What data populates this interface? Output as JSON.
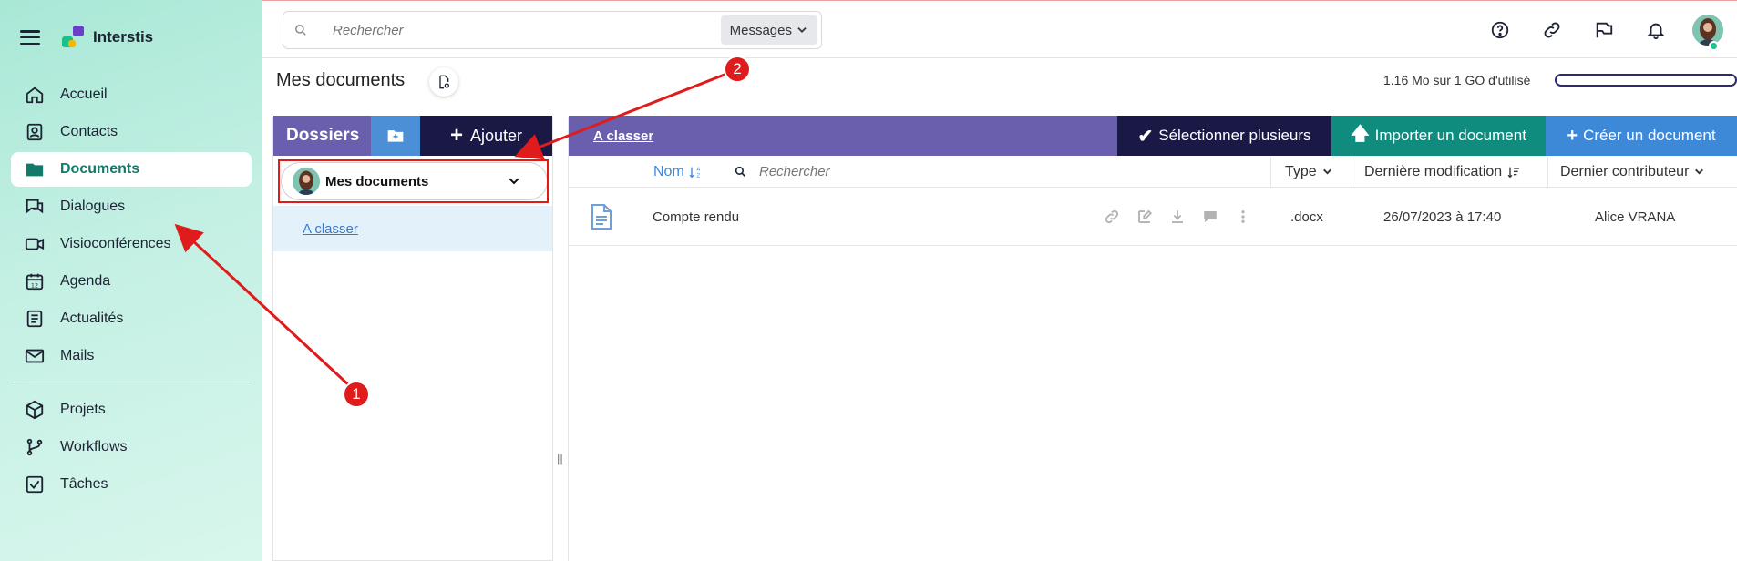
{
  "app": {
    "name": "Interstis"
  },
  "search": {
    "placeholder": "Rechercher",
    "scope": "Messages"
  },
  "sidebar": {
    "items": [
      {
        "label": "Accueil",
        "icon": "home-icon"
      },
      {
        "label": "Contacts",
        "icon": "contact-card-icon"
      },
      {
        "label": "Documents",
        "icon": "folder-icon",
        "active": true
      },
      {
        "label": "Dialogues",
        "icon": "chat-icon"
      },
      {
        "label": "Visioconférences",
        "icon": "video-icon"
      },
      {
        "label": "Agenda",
        "icon": "calendar-icon"
      },
      {
        "label": "Actualités",
        "icon": "news-icon"
      },
      {
        "label": "Mails",
        "icon": "mail-icon"
      },
      {
        "label": "Projets",
        "icon": "cube-icon"
      },
      {
        "label": "Workflows",
        "icon": "branch-icon"
      },
      {
        "label": "Tâches",
        "icon": "checkbox-icon"
      }
    ]
  },
  "topbar": {
    "icons": [
      "help-icon",
      "link-icon",
      "feedback-icon",
      "bell-icon",
      "user-avatar"
    ]
  },
  "page": {
    "title": "Mes documents",
    "usage": "1.16 Mo sur 1 GO d'utilisé",
    "usage_fraction": 0.001
  },
  "folders": {
    "title": "Dossiers",
    "add_label": "Ajouter",
    "selected": "Mes documents",
    "items": [
      "A classer"
    ]
  },
  "documents": {
    "path": "A classer",
    "buttons": {
      "select_multiple": "Sélectionner plusieurs",
      "import": "Importer un document",
      "create": "Créer un document"
    },
    "columns": {
      "name": "Nom",
      "search_placeholder": "Rechercher",
      "type": "Type",
      "modified": "Dernière modification",
      "contributor": "Dernier contributeur"
    },
    "rows": [
      {
        "name": "Compte rendu",
        "type": ".docx",
        "modified": "26/07/2023 à 17:40",
        "contributor": "Alice VRANA"
      }
    ]
  },
  "annotations": {
    "marker1": "1",
    "marker2": "2"
  },
  "colors": {
    "accent_purple": "#6a5fac",
    "navy": "#1a1845",
    "teal": "#0f8c7e",
    "blue": "#3e88d8",
    "annotation_red": "#e01b1b"
  }
}
